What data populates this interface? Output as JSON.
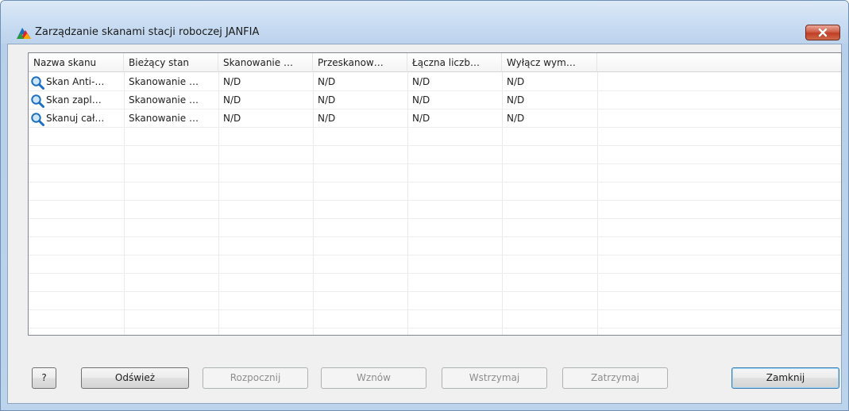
{
  "window": {
    "title": "Zarządzanie skanami stacji roboczej JANFIA",
    "close_icon": "close-icon",
    "app_icon": "avg-logo-icon"
  },
  "table": {
    "columns": [
      "Nazwa skanu",
      "Bieżący stan",
      "Skanowanie …",
      "Przeskanow…",
      "Łączna liczb…",
      "Wyłącz wym…"
    ],
    "rows": [
      {
        "icon": "magnifier-icon",
        "cells": [
          "Skan Anti-…",
          "Skanowanie …",
          "N/D",
          "N/D",
          "N/D",
          "N/D"
        ]
      },
      {
        "icon": "magnifier-icon",
        "cells": [
          "Skan zapl…",
          "Skanowanie …",
          "N/D",
          "N/D",
          "N/D",
          "N/D"
        ]
      },
      {
        "icon": "magnifier-icon",
        "cells": [
          "Skanuj cał…",
          "Skanowanie …",
          "N/D",
          "N/D",
          "N/D",
          "N/D"
        ]
      }
    ]
  },
  "buttons": {
    "help": "?",
    "refresh": "Odśwież",
    "start": "Rozpocznij",
    "resume": "Wznów",
    "pause": "Wstrzymaj",
    "stop": "Zatrzymaj",
    "close": "Zamknij"
  }
}
